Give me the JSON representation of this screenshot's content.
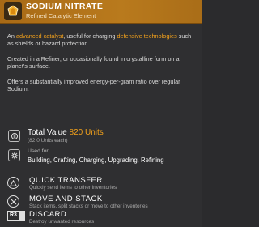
{
  "header": {
    "title": "SODIUM NITRATE",
    "subtitle": "Refined Catalytic Element",
    "icon": "sodium-nitrate-icon"
  },
  "description": {
    "p1": [
      "An ",
      "advanced catalyst",
      ", useful for charging ",
      "defensive technologies",
      " such as shields or hazard protection."
    ],
    "p2": "Created in a Refiner, or occasionally found in crystalline form on a planet's surface.",
    "p3": "Offers a substantially improved energy-per-gram ratio over regular Sodium."
  },
  "value": {
    "label": "Total Value",
    "amount": "820 Units",
    "each": "(82.0 Units each)",
    "icon": "units-currency-icon"
  },
  "used_for": {
    "label": "Used for:",
    "list": "Building, Crafting, Charging, Upgrading, Refining",
    "icon": "gear-icon"
  },
  "actions": [
    {
      "title": "QUICK TRANSFER",
      "desc": "Quickly send items to other inventories",
      "icon": "triangle-button-icon"
    },
    {
      "title": "MOVE AND STACK",
      "desc": "Stack items, split stacks or move to other inventories",
      "icon": "cross-button-icon"
    },
    {
      "title": "DISCARD",
      "desc": "Destroy unwanted resources",
      "icon": "r3-button-icon",
      "button_text": "R3"
    }
  ],
  "colors": {
    "header": "#b37518",
    "accent": "#f4a21b",
    "panel": "#2f2f31"
  }
}
